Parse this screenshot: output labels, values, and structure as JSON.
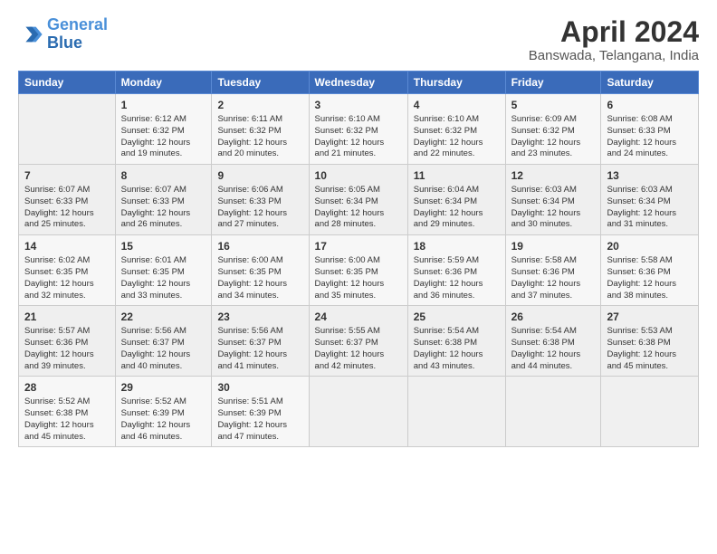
{
  "header": {
    "logo_line1": "General",
    "logo_line2": "Blue",
    "title": "April 2024",
    "subtitle": "Banswada, Telangana, India"
  },
  "days_of_week": [
    "Sunday",
    "Monday",
    "Tuesday",
    "Wednesday",
    "Thursday",
    "Friday",
    "Saturday"
  ],
  "weeks": [
    [
      {
        "day": "",
        "info": ""
      },
      {
        "day": "1",
        "info": "Sunrise: 6:12 AM\nSunset: 6:32 PM\nDaylight: 12 hours\nand 19 minutes."
      },
      {
        "day": "2",
        "info": "Sunrise: 6:11 AM\nSunset: 6:32 PM\nDaylight: 12 hours\nand 20 minutes."
      },
      {
        "day": "3",
        "info": "Sunrise: 6:10 AM\nSunset: 6:32 PM\nDaylight: 12 hours\nand 21 minutes."
      },
      {
        "day": "4",
        "info": "Sunrise: 6:10 AM\nSunset: 6:32 PM\nDaylight: 12 hours\nand 22 minutes."
      },
      {
        "day": "5",
        "info": "Sunrise: 6:09 AM\nSunset: 6:32 PM\nDaylight: 12 hours\nand 23 minutes."
      },
      {
        "day": "6",
        "info": "Sunrise: 6:08 AM\nSunset: 6:33 PM\nDaylight: 12 hours\nand 24 minutes."
      }
    ],
    [
      {
        "day": "7",
        "info": "Sunrise: 6:07 AM\nSunset: 6:33 PM\nDaylight: 12 hours\nand 25 minutes."
      },
      {
        "day": "8",
        "info": "Sunrise: 6:07 AM\nSunset: 6:33 PM\nDaylight: 12 hours\nand 26 minutes."
      },
      {
        "day": "9",
        "info": "Sunrise: 6:06 AM\nSunset: 6:33 PM\nDaylight: 12 hours\nand 27 minutes."
      },
      {
        "day": "10",
        "info": "Sunrise: 6:05 AM\nSunset: 6:34 PM\nDaylight: 12 hours\nand 28 minutes."
      },
      {
        "day": "11",
        "info": "Sunrise: 6:04 AM\nSunset: 6:34 PM\nDaylight: 12 hours\nand 29 minutes."
      },
      {
        "day": "12",
        "info": "Sunrise: 6:03 AM\nSunset: 6:34 PM\nDaylight: 12 hours\nand 30 minutes."
      },
      {
        "day": "13",
        "info": "Sunrise: 6:03 AM\nSunset: 6:34 PM\nDaylight: 12 hours\nand 31 minutes."
      }
    ],
    [
      {
        "day": "14",
        "info": "Sunrise: 6:02 AM\nSunset: 6:35 PM\nDaylight: 12 hours\nand 32 minutes."
      },
      {
        "day": "15",
        "info": "Sunrise: 6:01 AM\nSunset: 6:35 PM\nDaylight: 12 hours\nand 33 minutes."
      },
      {
        "day": "16",
        "info": "Sunrise: 6:00 AM\nSunset: 6:35 PM\nDaylight: 12 hours\nand 34 minutes."
      },
      {
        "day": "17",
        "info": "Sunrise: 6:00 AM\nSunset: 6:35 PM\nDaylight: 12 hours\nand 35 minutes."
      },
      {
        "day": "18",
        "info": "Sunrise: 5:59 AM\nSunset: 6:36 PM\nDaylight: 12 hours\nand 36 minutes."
      },
      {
        "day": "19",
        "info": "Sunrise: 5:58 AM\nSunset: 6:36 PM\nDaylight: 12 hours\nand 37 minutes."
      },
      {
        "day": "20",
        "info": "Sunrise: 5:58 AM\nSunset: 6:36 PM\nDaylight: 12 hours\nand 38 minutes."
      }
    ],
    [
      {
        "day": "21",
        "info": "Sunrise: 5:57 AM\nSunset: 6:36 PM\nDaylight: 12 hours\nand 39 minutes."
      },
      {
        "day": "22",
        "info": "Sunrise: 5:56 AM\nSunset: 6:37 PM\nDaylight: 12 hours\nand 40 minutes."
      },
      {
        "day": "23",
        "info": "Sunrise: 5:56 AM\nSunset: 6:37 PM\nDaylight: 12 hours\nand 41 minutes."
      },
      {
        "day": "24",
        "info": "Sunrise: 5:55 AM\nSunset: 6:37 PM\nDaylight: 12 hours\nand 42 minutes."
      },
      {
        "day": "25",
        "info": "Sunrise: 5:54 AM\nSunset: 6:38 PM\nDaylight: 12 hours\nand 43 minutes."
      },
      {
        "day": "26",
        "info": "Sunrise: 5:54 AM\nSunset: 6:38 PM\nDaylight: 12 hours\nand 44 minutes."
      },
      {
        "day": "27",
        "info": "Sunrise: 5:53 AM\nSunset: 6:38 PM\nDaylight: 12 hours\nand 45 minutes."
      }
    ],
    [
      {
        "day": "28",
        "info": "Sunrise: 5:52 AM\nSunset: 6:38 PM\nDaylight: 12 hours\nand 45 minutes."
      },
      {
        "day": "29",
        "info": "Sunrise: 5:52 AM\nSunset: 6:39 PM\nDaylight: 12 hours\nand 46 minutes."
      },
      {
        "day": "30",
        "info": "Sunrise: 5:51 AM\nSunset: 6:39 PM\nDaylight: 12 hours\nand 47 minutes."
      },
      {
        "day": "",
        "info": ""
      },
      {
        "day": "",
        "info": ""
      },
      {
        "day": "",
        "info": ""
      },
      {
        "day": "",
        "info": ""
      }
    ]
  ]
}
